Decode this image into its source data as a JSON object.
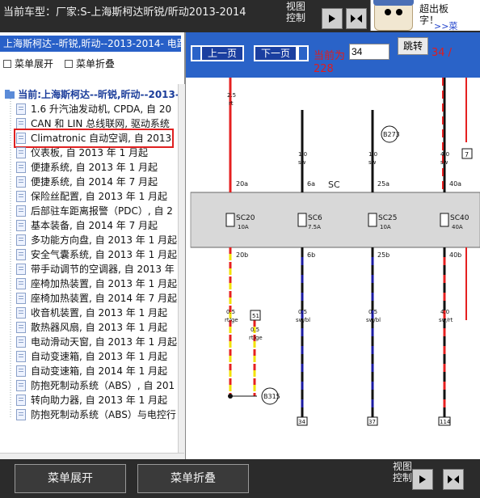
{
  "header": {
    "title": "当前车型：厂家:S-上海斯柯达昕锐/昕动2013-2014",
    "view_control": "视图控制",
    "ad": {
      "line1": "超出板",
      "line2": "字！",
      "link": ">>菜"
    }
  },
  "left_panel": {
    "caption": "上海斯柯达--昕锐,昕动--2013-2014- 电路",
    "ops": {
      "expand": "菜单展开",
      "collapse": "菜单折叠"
    },
    "root": "当前:上海斯柯达--昕锐,昕动--2013-2",
    "items": [
      "1.6 升汽油发动机, CPDA, 自 20",
      "CAN 和 LIN 总线联网, 驱动系统",
      "Climatronic 自动空调, 自 2013",
      "仪表板, 自 2013 年 1 月起",
      "便捷系统, 自 2013 年 1 月起",
      "便捷系统, 自 2014 年 7 月起",
      "保险丝配置, 自 2013 年 1 月起",
      "后部驻车距离报警（PDC）, 自 2",
      "基本装备, 自 2014 年 7 月起",
      "多功能方向盘, 自 2013 年 1 月起",
      "安全气囊系统, 自 2013 年 1 月起",
      "带手动调节的空调器, 自 2013 年",
      "座椅加热装置, 自 2013 年 1 月起",
      "座椅加热装置, 自 2014 年 7 月起",
      "收音机装置, 自 2013 年 1 月起",
      "散热器风扇, 自 2013 年 1 月起",
      "电动滑动天窗, 自 2013 年 1 月起",
      "自动变速箱, 自 2013 年 1 月起",
      "自动变速箱, 自 2014 年 1 月起",
      "防抱死制动系统（ABS）, 自 201",
      "转向助力器, 自 2013 年 1 月起",
      "防抱死制动系统（ABS）与电控行"
    ],
    "selected_index": 2
  },
  "toolbar": {
    "prev": "上一页",
    "next": "下一页",
    "current_label": "当前为",
    "page_value": "34",
    "goto": "跳转",
    "page_of": "34 /",
    "total": "228"
  },
  "diagram": {
    "connector_top": [
      "2.5",
      "rt",
      "1.0",
      "sw",
      "1.0",
      "sw",
      "4.0",
      "sw"
    ],
    "fuses": [
      {
        "name": "SC20",
        "amp": "10A",
        "pin_top": "20a",
        "pin_bottom": "20b"
      },
      {
        "name": "SC6",
        "amp": "7.5A",
        "pin_top": "6a",
        "pin_bottom": "6b"
      },
      {
        "name": "SC25",
        "amp": "10A",
        "pin_top": "25a",
        "pin_bottom": "25b"
      },
      {
        "name": "SC40",
        "amp": "40A",
        "pin_top": "40a",
        "pin_bottom": "40b"
      }
    ],
    "bus_label": "SC",
    "component_labels": [
      "B273",
      "B315"
    ],
    "pin_labels": [
      "7",
      "51",
      "34",
      "37",
      "114"
    ],
    "wire_labels": [
      "0.5",
      "rt/ge",
      "0.5",
      "rt/ge",
      "0.5",
      "sw/bl",
      "0.5",
      "sw/bl",
      "4.0",
      "sw/rt"
    ]
  },
  "bottom": {
    "expand": "菜单展开",
    "collapse": "菜单折叠",
    "view_control": "视图控制"
  },
  "colors": {
    "accent": "#2a63c8",
    "highlight": "#e02020"
  }
}
